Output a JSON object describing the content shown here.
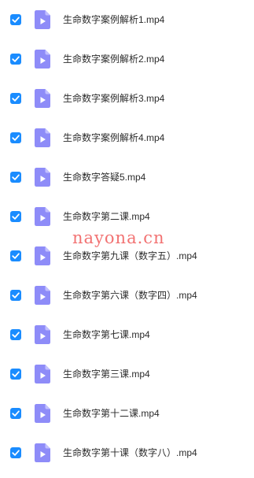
{
  "colors": {
    "checkbox": "#1a8cff",
    "file_icon": "#8e8cf8",
    "file_icon_fold": "#c2c0ff",
    "text": "#2b2b2b",
    "watermark": "#f05a5a"
  },
  "icons": {
    "checkbox": "checkmark-icon",
    "file": "video-file-icon"
  },
  "files": [
    {
      "name": "生命数字案例解析1.mp4",
      "checked": true
    },
    {
      "name": "生命数字案例解析2.mp4",
      "checked": true
    },
    {
      "name": "生命数字案例解析3.mp4",
      "checked": true
    },
    {
      "name": "生命数字案例解析4.mp4",
      "checked": true
    },
    {
      "name": "生命数字答疑5.mp4",
      "checked": true
    },
    {
      "name": "生命数字第二课.mp4",
      "checked": true
    },
    {
      "name": "生命数字第九课（数字五）.mp4",
      "checked": true
    },
    {
      "name": "生命数字第六课（数字四）.mp4",
      "checked": true
    },
    {
      "name": "生命数字第七课.mp4",
      "checked": true
    },
    {
      "name": "生命数字第三课.mp4",
      "checked": true
    },
    {
      "name": "生命数字第十二课.mp4",
      "checked": true
    },
    {
      "name": "生命数字第十课（数字八）.mp4",
      "checked": true
    }
  ],
  "watermark": {
    "text": "nayona.cn"
  }
}
